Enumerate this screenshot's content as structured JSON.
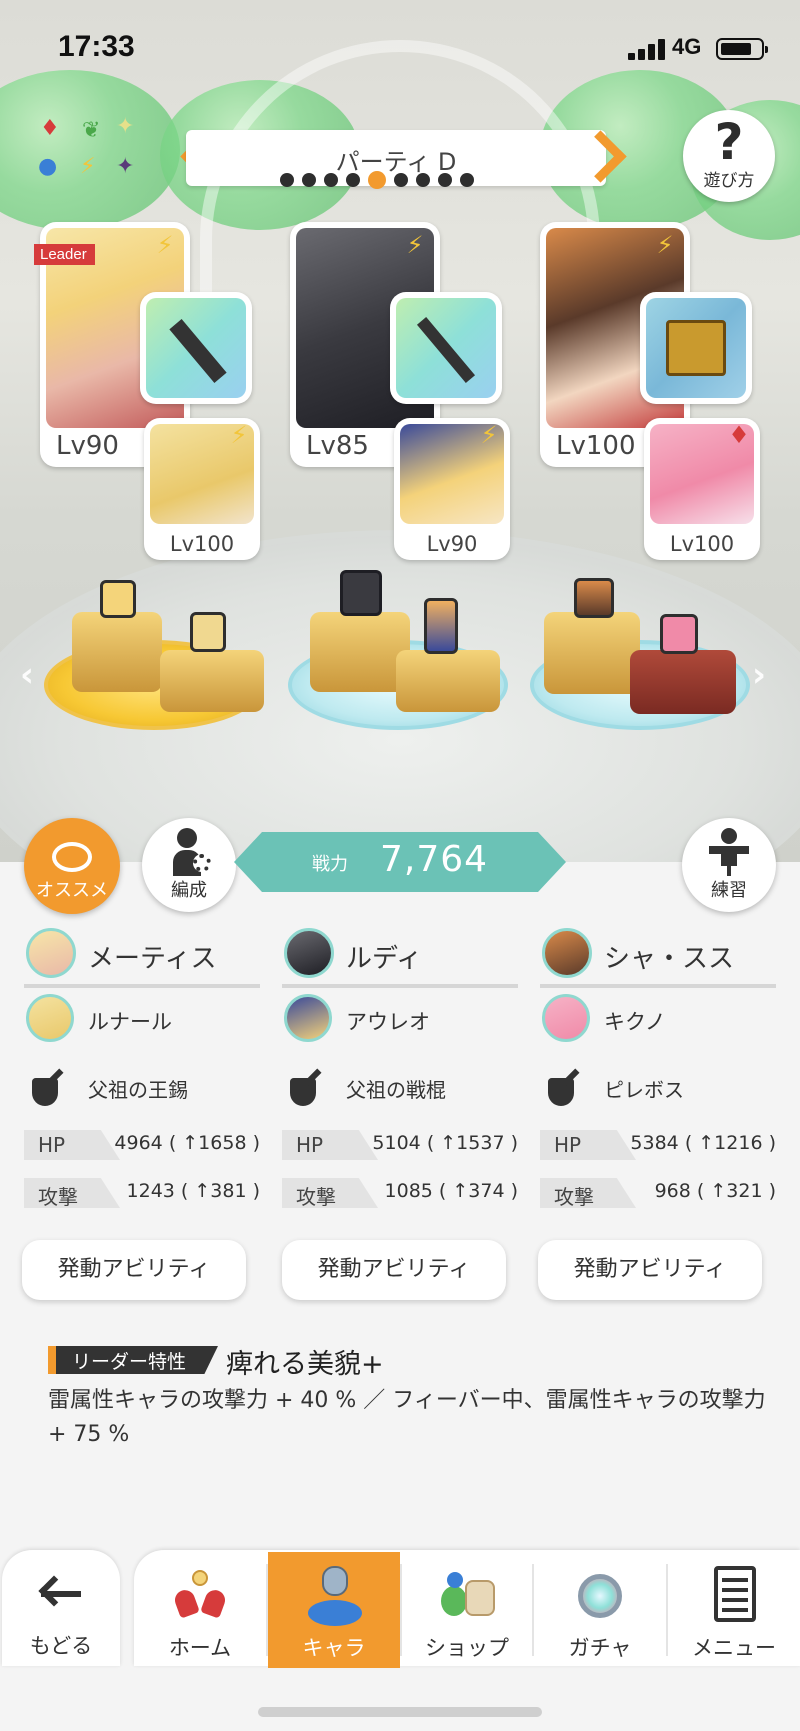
{
  "status_bar": {
    "time": "17:33",
    "network": "4G"
  },
  "party": {
    "name": "パーティ D",
    "page_count": 9,
    "current_page": 5
  },
  "help": {
    "label": "遊び方"
  },
  "leader_badge": "Leader",
  "characters": [
    {
      "main": {
        "name": "メーティス",
        "level": "Lv90"
      },
      "sub": {
        "name": "ルナール",
        "level": "Lv100"
      },
      "weapon": "父祖の王錫",
      "hp": "4964 ( ↑1658 )",
      "atk": "1243 ( ↑381 )"
    },
    {
      "main": {
        "name": "ルディ",
        "level": "Lv85"
      },
      "sub": {
        "name": "アウレオ",
        "level": "Lv90"
      },
      "weapon": "父祖の戦棍",
      "hp": "5104 ( ↑1537 )",
      "atk": "1085 ( ↑374 )"
    },
    {
      "main": {
        "name": "シャ・スス",
        "level": "Lv100"
      },
      "sub": {
        "name": "キクノ",
        "level": "Lv100"
      },
      "weapon": "ピレボス",
      "hp": "5384 ( ↑1216 )",
      "atk": "968 ( ↑321 )"
    }
  ],
  "stats_labels": {
    "hp": "HP",
    "atk": "攻撃"
  },
  "power": {
    "label": "戦力",
    "value": "7,764"
  },
  "buttons": {
    "recommend": "オススメ",
    "formation": "編成",
    "practice": "練習",
    "ability": "発動アビリティ"
  },
  "leader_trait": {
    "tag": "リーダー特性",
    "name": "痺れる美貌+",
    "description": "雷属性キャラの攻撃力 + 40 % ／ フィーバー中、雷属性キャラの攻撃力 + 75 %"
  },
  "nav": {
    "back": "もどる",
    "items": [
      "ホーム",
      "キャラ",
      "ショップ",
      "ガチャ",
      "メニュー"
    ],
    "active": "キャラ"
  },
  "colors": {
    "accent": "#f29a2e",
    "teal": "#6bc2b6",
    "leader": "#d63b3b",
    "lightning": "#f2c53a"
  }
}
